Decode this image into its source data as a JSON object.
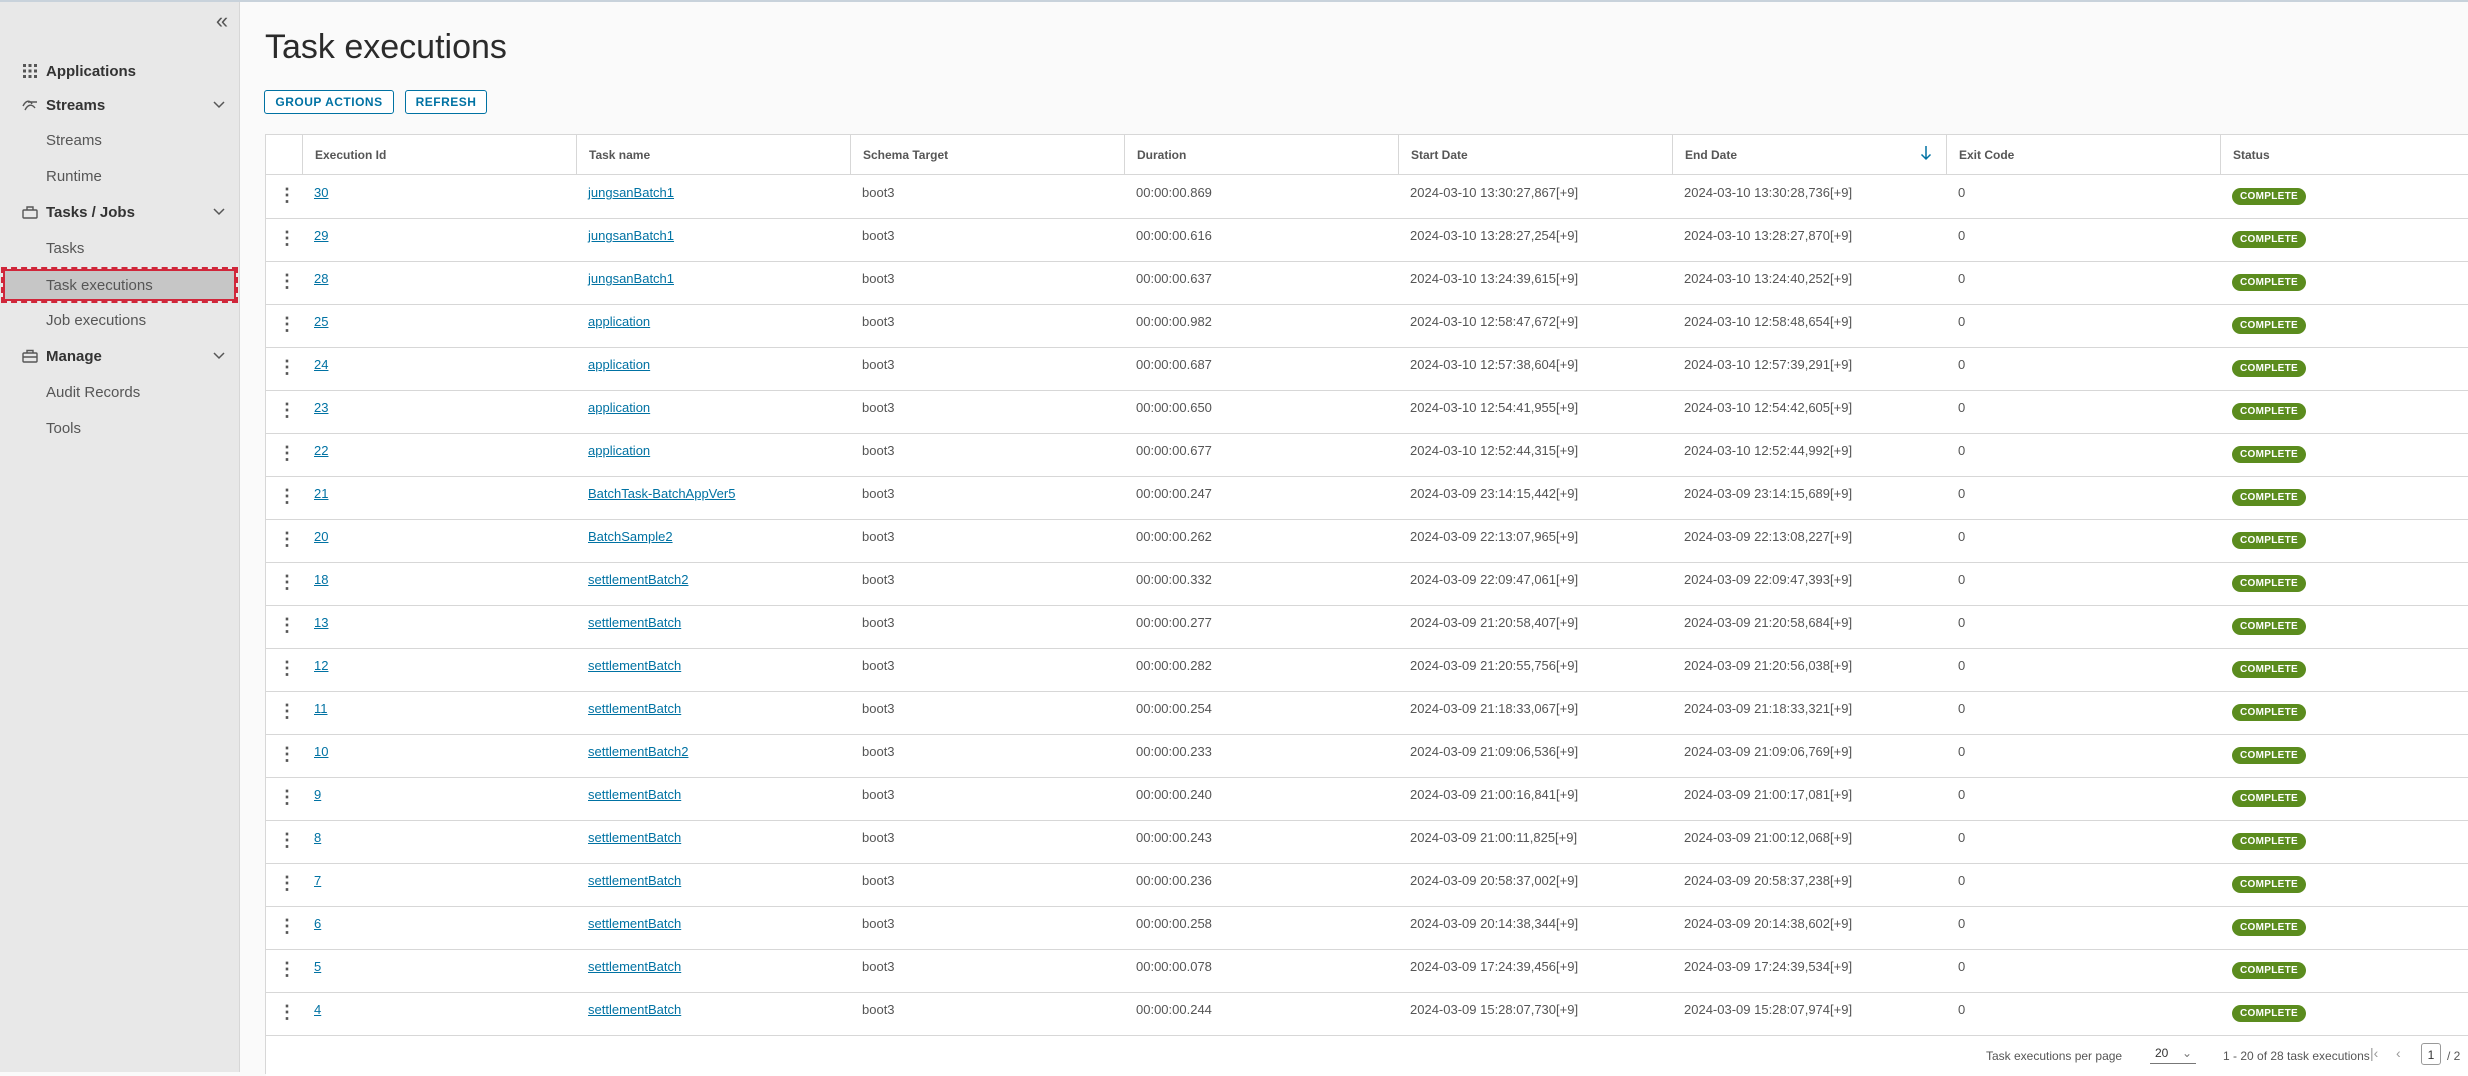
{
  "sidebar": {
    "collapse_icon": "double-chevron-left-icon",
    "applications": {
      "label": "Applications",
      "icon": "grid-icon"
    },
    "streams": {
      "label": "Streams",
      "icon": "streams-icon",
      "items": [
        "Streams",
        "Runtime"
      ]
    },
    "tasks_jobs": {
      "label": "Tasks / Jobs",
      "icon": "layers-icon",
      "items": [
        "Tasks",
        "Task executions",
        "Job executions"
      ]
    },
    "manage": {
      "label": "Manage",
      "icon": "briefcase-icon",
      "items": [
        "Audit Records",
        "Tools"
      ]
    },
    "active_item": "Task executions"
  },
  "page": {
    "title": "Task executions",
    "group_actions": "GROUP ACTIONS",
    "refresh": "REFRESH"
  },
  "table": {
    "columns": [
      "Execution Id",
      "Task name",
      "Schema Target",
      "Duration",
      "Start Date",
      "End Date",
      "Exit Code",
      "Status"
    ],
    "sorted_by": "End Date",
    "sort_direction": "descending",
    "rows": [
      {
        "id": "30",
        "name": "jungsanBatch1",
        "schema": "boot3",
        "duration": "00:00:00.869",
        "start": "2024-03-10 13:30:27,867[+9]",
        "end": "2024-03-10 13:30:28,736[+9]",
        "exit": "0",
        "status": "COMPLETE"
      },
      {
        "id": "29",
        "name": "jungsanBatch1",
        "schema": "boot3",
        "duration": "00:00:00.616",
        "start": "2024-03-10 13:28:27,254[+9]",
        "end": "2024-03-10 13:28:27,870[+9]",
        "exit": "0",
        "status": "COMPLETE"
      },
      {
        "id": "28",
        "name": "jungsanBatch1",
        "schema": "boot3",
        "duration": "00:00:00.637",
        "start": "2024-03-10 13:24:39,615[+9]",
        "end": "2024-03-10 13:24:40,252[+9]",
        "exit": "0",
        "status": "COMPLETE"
      },
      {
        "id": "25",
        "name": "application",
        "schema": "boot3",
        "duration": "00:00:00.982",
        "start": "2024-03-10 12:58:47,672[+9]",
        "end": "2024-03-10 12:58:48,654[+9]",
        "exit": "0",
        "status": "COMPLETE"
      },
      {
        "id": "24",
        "name": "application",
        "schema": "boot3",
        "duration": "00:00:00.687",
        "start": "2024-03-10 12:57:38,604[+9]",
        "end": "2024-03-10 12:57:39,291[+9]",
        "exit": "0",
        "status": "COMPLETE"
      },
      {
        "id": "23",
        "name": "application",
        "schema": "boot3",
        "duration": "00:00:00.650",
        "start": "2024-03-10 12:54:41,955[+9]",
        "end": "2024-03-10 12:54:42,605[+9]",
        "exit": "0",
        "status": "COMPLETE"
      },
      {
        "id": "22",
        "name": "application",
        "schema": "boot3",
        "duration": "00:00:00.677",
        "start": "2024-03-10 12:52:44,315[+9]",
        "end": "2024-03-10 12:52:44,992[+9]",
        "exit": "0",
        "status": "COMPLETE"
      },
      {
        "id": "21",
        "name": "BatchTask-BatchAppVer5",
        "schema": "boot3",
        "duration": "00:00:00.247",
        "start": "2024-03-09 23:14:15,442[+9]",
        "end": "2024-03-09 23:14:15,689[+9]",
        "exit": "0",
        "status": "COMPLETE"
      },
      {
        "id": "20",
        "name": "BatchSample2",
        "schema": "boot3",
        "duration": "00:00:00.262",
        "start": "2024-03-09 22:13:07,965[+9]",
        "end": "2024-03-09 22:13:08,227[+9]",
        "exit": "0",
        "status": "COMPLETE"
      },
      {
        "id": "18",
        "name": "settlementBatch2",
        "schema": "boot3",
        "duration": "00:00:00.332",
        "start": "2024-03-09 22:09:47,061[+9]",
        "end": "2024-03-09 22:09:47,393[+9]",
        "exit": "0",
        "status": "COMPLETE"
      },
      {
        "id": "13",
        "name": "settlementBatch",
        "schema": "boot3",
        "duration": "00:00:00.277",
        "start": "2024-03-09 21:20:58,407[+9]",
        "end": "2024-03-09 21:20:58,684[+9]",
        "exit": "0",
        "status": "COMPLETE"
      },
      {
        "id": "12",
        "name": "settlementBatch",
        "schema": "boot3",
        "duration": "00:00:00.282",
        "start": "2024-03-09 21:20:55,756[+9]",
        "end": "2024-03-09 21:20:56,038[+9]",
        "exit": "0",
        "status": "COMPLETE"
      },
      {
        "id": "11",
        "name": "settlementBatch",
        "schema": "boot3",
        "duration": "00:00:00.254",
        "start": "2024-03-09 21:18:33,067[+9]",
        "end": "2024-03-09 21:18:33,321[+9]",
        "exit": "0",
        "status": "COMPLETE"
      },
      {
        "id": "10",
        "name": "settlementBatch2",
        "schema": "boot3",
        "duration": "00:00:00.233",
        "start": "2024-03-09 21:09:06,536[+9]",
        "end": "2024-03-09 21:09:06,769[+9]",
        "exit": "0",
        "status": "COMPLETE"
      },
      {
        "id": "9",
        "name": "settlementBatch",
        "schema": "boot3",
        "duration": "00:00:00.240",
        "start": "2024-03-09 21:00:16,841[+9]",
        "end": "2024-03-09 21:00:17,081[+9]",
        "exit": "0",
        "status": "COMPLETE"
      },
      {
        "id": "8",
        "name": "settlementBatch",
        "schema": "boot3",
        "duration": "00:00:00.243",
        "start": "2024-03-09 21:00:11,825[+9]",
        "end": "2024-03-09 21:00:12,068[+9]",
        "exit": "0",
        "status": "COMPLETE"
      },
      {
        "id": "7",
        "name": "settlementBatch",
        "schema": "boot3",
        "duration": "00:00:00.236",
        "start": "2024-03-09 20:58:37,002[+9]",
        "end": "2024-03-09 20:58:37,238[+9]",
        "exit": "0",
        "status": "COMPLETE"
      },
      {
        "id": "6",
        "name": "settlementBatch",
        "schema": "boot3",
        "duration": "00:00:00.258",
        "start": "2024-03-09 20:14:38,344[+9]",
        "end": "2024-03-09 20:14:38,602[+9]",
        "exit": "0",
        "status": "COMPLETE"
      },
      {
        "id": "5",
        "name": "settlementBatch",
        "schema": "boot3",
        "duration": "00:00:00.078",
        "start": "2024-03-09 17:24:39,456[+9]",
        "end": "2024-03-09 17:24:39,534[+9]",
        "exit": "0",
        "status": "COMPLETE"
      },
      {
        "id": "4",
        "name": "settlementBatch",
        "schema": "boot3",
        "duration": "00:00:00.244",
        "start": "2024-03-09 15:28:07,730[+9]",
        "end": "2024-03-09 15:28:07,974[+9]",
        "exit": "0",
        "status": "COMPLETE"
      }
    ]
  },
  "footer": {
    "per_page_label": "Task executions per page",
    "per_page_value": "20",
    "range_text": "1 - 20 of 28 task executions",
    "current_page": "1",
    "total_pages": "/ 2"
  },
  "colors": {
    "accent": "#0072a3",
    "status_complete": "#5b8c1e",
    "active_outline": "#d0263a"
  }
}
